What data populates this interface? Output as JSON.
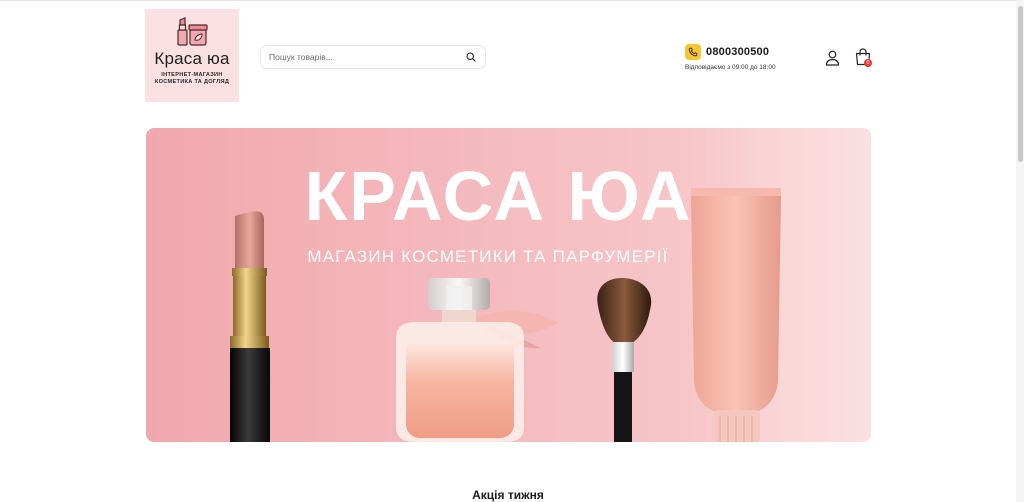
{
  "header": {
    "logo": {
      "brand": "Краса юа",
      "tagline_line1": "ІНТЕРНЕТ-МАГАЗИН",
      "tagline_line2": "КОСМЕТИКА ТА ДОГЛЯД"
    },
    "search": {
      "placeholder": "Пошук товарів...",
      "icon": "search-icon"
    },
    "contact": {
      "phone": "0800300500",
      "hours": "Відповідаємо з 09:00 до 18:00",
      "icon": "phone-icon"
    },
    "account_icon": "user-icon",
    "cart": {
      "icon": "shopping-bag-icon",
      "count": "0"
    }
  },
  "banner": {
    "title": "КРАСА ЮА",
    "subtitle": "МАГАЗИН КОСМЕТИКИ ТА ПАРФУМЕРІЇ"
  },
  "sections": {
    "weekly_promo_title": "Акція тижня"
  },
  "colors": {
    "logo_bg": "#fbe1e4",
    "banner_pink": "#f4b6ba",
    "phone_icon_bg": "#f6c533",
    "cart_badge": "#e53935"
  }
}
